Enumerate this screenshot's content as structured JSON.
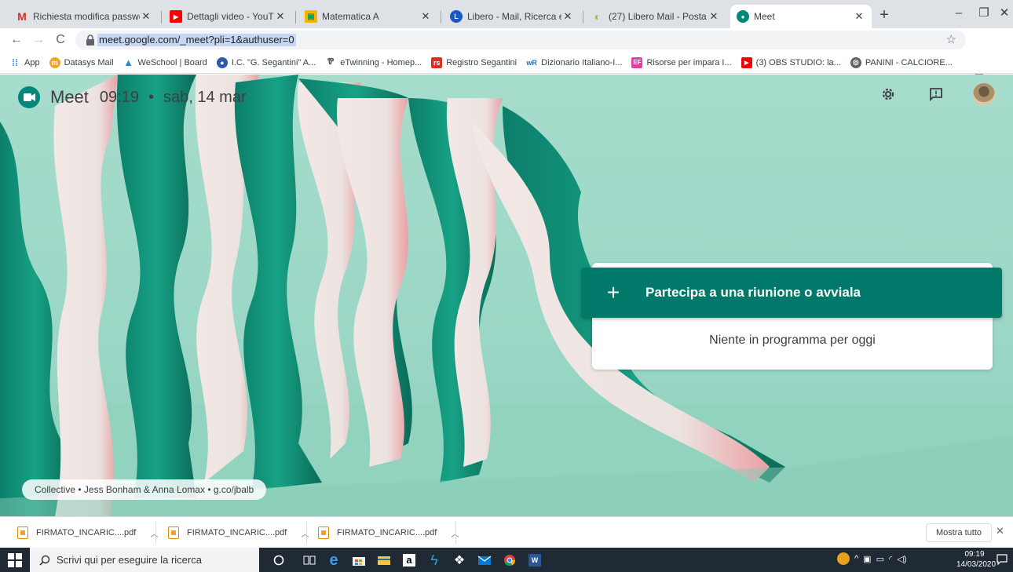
{
  "browser": {
    "tabs": [
      {
        "title": "Richiesta modifica password",
        "icon": "gmail-icon",
        "active": false
      },
      {
        "title": "Dettagli video - YouTube Stu",
        "icon": "youtube-icon",
        "active": false
      },
      {
        "title": "Matematica A",
        "icon": "classroom-icon",
        "active": false
      },
      {
        "title": "Libero - Mail, Ricerca e tanto",
        "icon": "libero-icon",
        "active": false
      },
      {
        "title": "(27) Libero Mail - Posta",
        "icon": "libero-mail-icon",
        "active": false
      },
      {
        "title": "Meet",
        "icon": "meet-icon",
        "active": true
      }
    ],
    "new_tab_symbol": "+",
    "url": "meet.google.com/_meet?pli=1&authuser=0",
    "bookmarks": [
      {
        "label": "App",
        "icon": "apps-grid-icon",
        "color": "#4285f4"
      },
      {
        "label": "Datasys Mail",
        "icon": "datasys-icon",
        "color": "#f5a623"
      },
      {
        "label": "WeSchool | Board",
        "icon": "weschool-icon",
        "color": "#1e88e5"
      },
      {
        "label": "I.C. \"G. Segantini\" A...",
        "icon": "school-icon",
        "color": "#2e5aa8"
      },
      {
        "label": "eTwinning - Homep...",
        "icon": "etwinning-icon",
        "color": "#555555"
      },
      {
        "label": "Registro Segantini",
        "icon": "registro-icon",
        "color": "#d93025"
      },
      {
        "label": "Dizionario Italiano-I...",
        "icon": "wordreference-icon",
        "color": "#2b6cb0"
      },
      {
        "label": "Risorse per impara I...",
        "icon": "ef-icon",
        "color": "#e040a0"
      },
      {
        "label": "(3) OBS STUDIO: la...",
        "icon": "youtube-icon",
        "color": "#ff0000"
      },
      {
        "label": "PANINI - CALCIORE...",
        "icon": "globe-icon",
        "color": "#5f6368"
      }
    ]
  },
  "meet": {
    "brand": "Meet",
    "time": "09:19",
    "separator": "•",
    "date": "sab, 14 mar",
    "join_button": "Partecipa a una riunione o avviala",
    "join_plus": "+",
    "empty_message": "Niente in programma per oggi",
    "credit": "Collective • Jess Bonham & Anna Lomax • g.co/jbalb",
    "colors": {
      "accent": "#00796b",
      "background": "#a6dccc"
    }
  },
  "downloads": {
    "items": [
      {
        "name": "FIRMATO_INCARIC....pdf"
      },
      {
        "name": "FIRMATO_INCARIC....pdf"
      },
      {
        "name": "FIRMATO_INCARIC....pdf"
      }
    ],
    "show_all": "Mostra tutto"
  },
  "taskbar": {
    "search_placeholder": "Scrivi qui per eseguire la ricerca",
    "time": "09:19",
    "date": "14/03/2020"
  }
}
